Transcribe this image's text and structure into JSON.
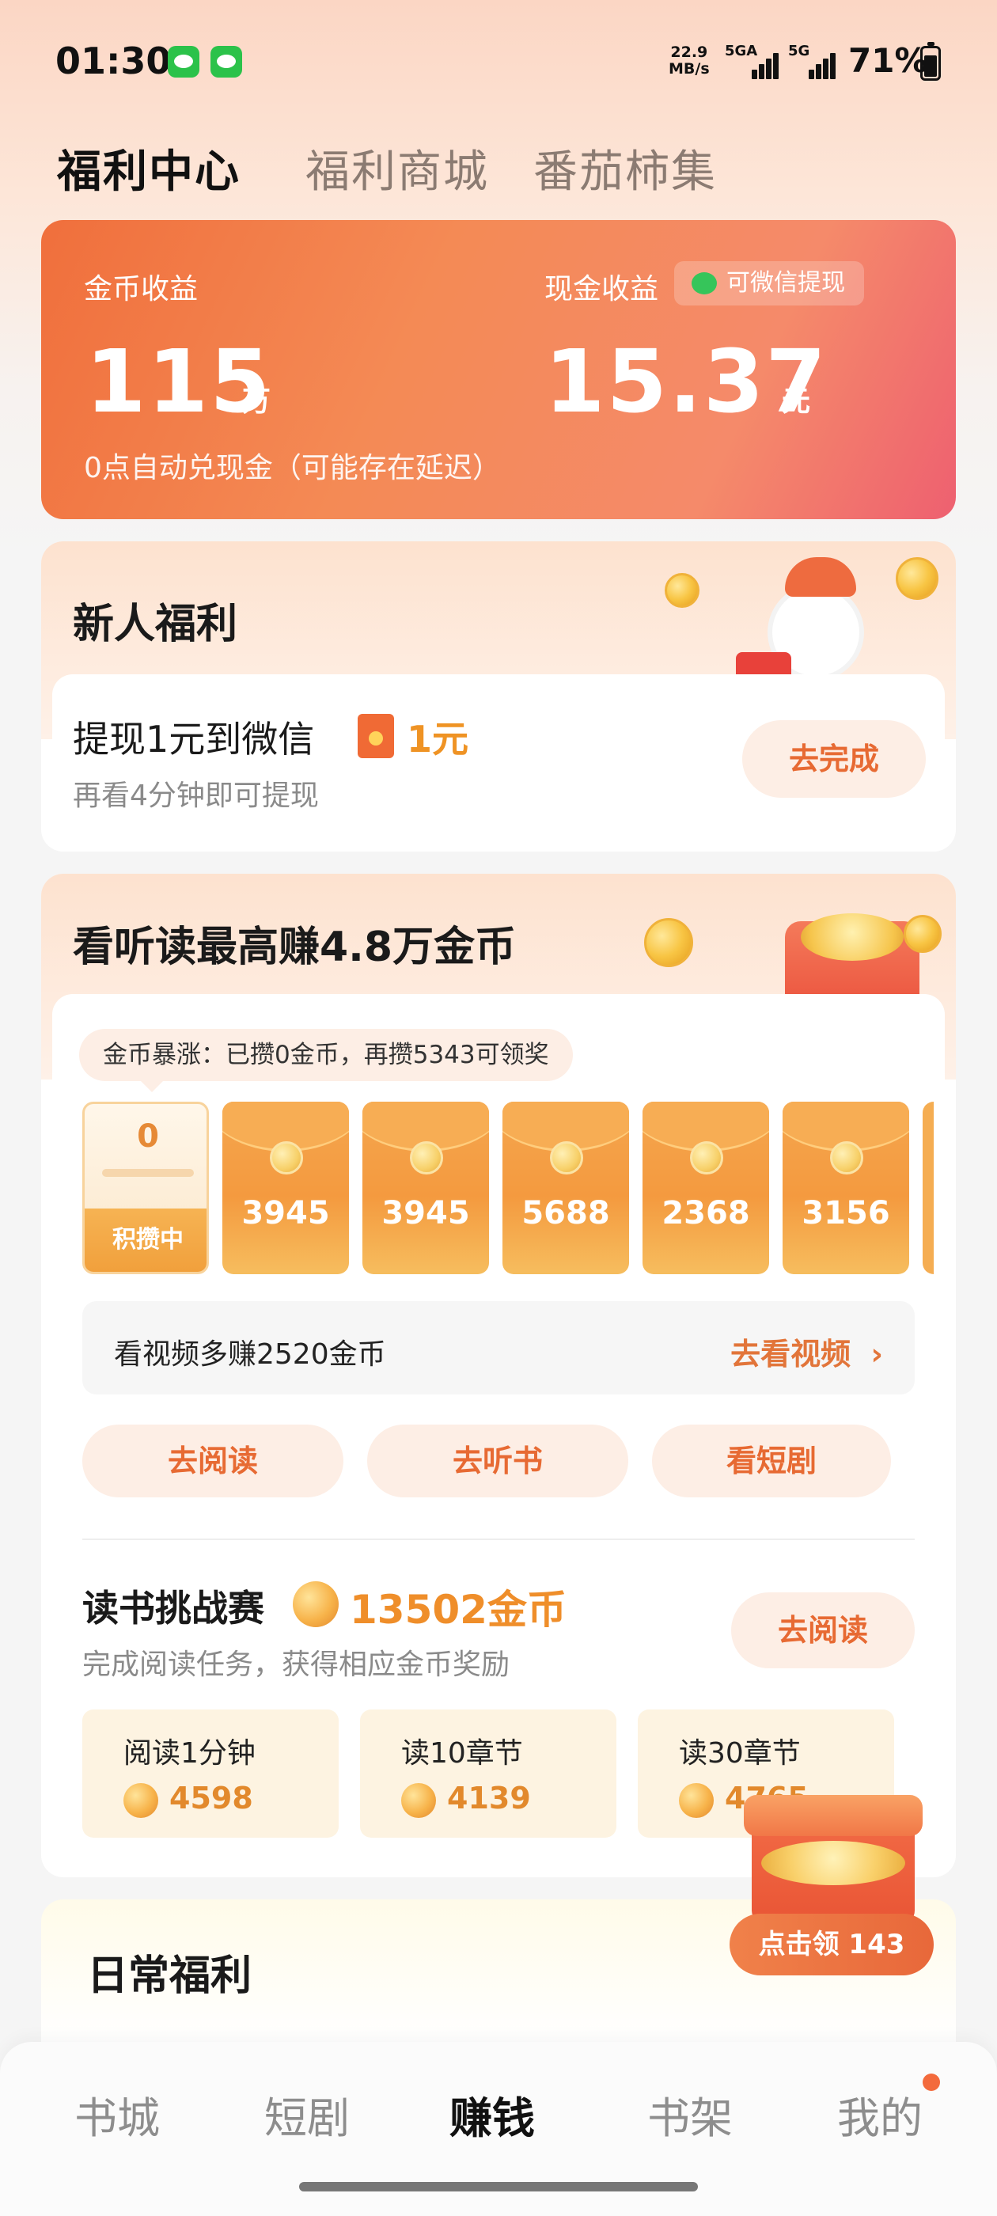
{
  "status_bar": {
    "time": "01:30",
    "net_speed": "22.9",
    "net_speed_unit": "MB/s",
    "sim1": "5GA",
    "sim2": "5G",
    "battery": "71%"
  },
  "tabs": [
    {
      "label": "福利中心",
      "active": true
    },
    {
      "label": "福利商城",
      "active": false
    },
    {
      "label": "番茄柿集",
      "active": false
    }
  ],
  "earnings": {
    "coin_label": "金币收益",
    "coin_value": "115",
    "coin_unit": "万",
    "cash_label": "现金收益",
    "wechat_badge": "可微信提现",
    "cash_value": "15.37",
    "cash_unit": "元",
    "note": "0点自动兑现金（可能存在延迟）"
  },
  "newbie": {
    "title": "新人福利",
    "task": "提现1元到微信",
    "reward": "1元",
    "sub": "再看4分钟即可提现",
    "button": "去完成"
  },
  "reading": {
    "title": "看听读最高赚4.8万金币",
    "boost": "金币暴涨：已攒0金币，再攒5343可领奖",
    "first_packet": {
      "value": "0",
      "label": "积攒中"
    },
    "packets": [
      "3945",
      "3945",
      "5688",
      "2368",
      "3156"
    ],
    "video_text": "看视频多赚2520金币",
    "video_link": "去看视频",
    "actions": [
      "去阅读",
      "去听书",
      "看短剧"
    ]
  },
  "challenge": {
    "title": "读书挑战赛",
    "coins": "13502金币",
    "sub": "完成阅读任务，获得相应金币奖励",
    "button": "去阅读",
    "tasks": [
      {
        "name": "阅读1分钟",
        "coins": "4598"
      },
      {
        "name": "读10章节",
        "coins": "4139"
      },
      {
        "name": "读30章节",
        "coins": "4765"
      }
    ]
  },
  "chest": {
    "label": "点击领 143"
  },
  "daily": {
    "title": "日常福利"
  },
  "nav": [
    {
      "label": "书城",
      "active": false
    },
    {
      "label": "短剧",
      "active": false
    },
    {
      "label": "赚钱",
      "active": true
    },
    {
      "label": "书架",
      "active": false
    },
    {
      "label": "我的",
      "active": false
    }
  ],
  "colors": {
    "accent": "#e76a33",
    "earn_card": "#f27c4a",
    "coin": "#f5b040"
  }
}
